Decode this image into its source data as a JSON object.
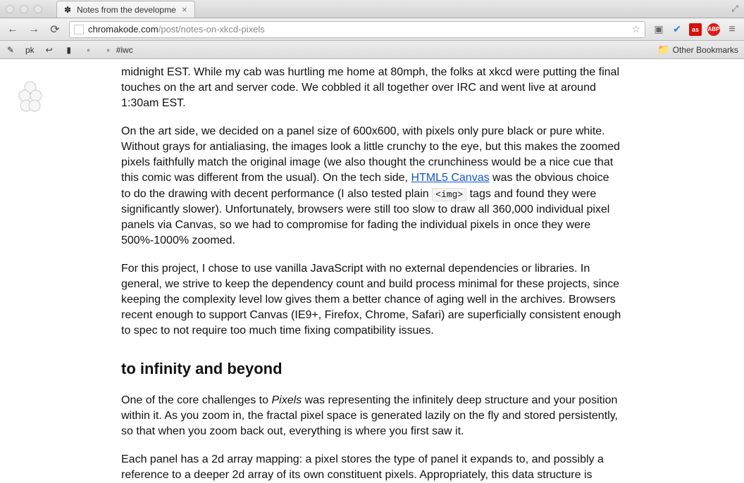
{
  "tab": {
    "title": "Notes from the developme",
    "close": "×"
  },
  "url": {
    "domain": "chromakode.com",
    "path": "/post/notes-on-xkcd-pixels"
  },
  "bookmarks": {
    "item1": "pk",
    "hashtag": "#iwc",
    "other": "Other Bookmarks"
  },
  "article": {
    "p1": "midnight EST. While my cab was hurtling me home at 80mph, the folks at xkcd were putting the final touches on the art and server code. We cobbled it all together over IRC and went live at around 1:30am EST.",
    "p2a": "On the art side, we decided on a panel size of 600x600, with pixels only pure black or pure white. Without grays for antialiasing, the images look a little crunchy to the eye, but this makes the zoomed pixels faithfully match the original image (we also thought the crunchiness would be a nice cue that this comic was different from the usual). On the tech side, ",
    "p2_link": "HTML5 Canvas",
    "p2b": " was the obvious choice to do the drawing with decent performance (I also tested plain ",
    "p2_code": "<img>",
    "p2c": " tags and found they were significantly slower). Unfortunately, browsers were still too slow to draw all 360,000 individual pixel panels via Canvas, so we had to compromise for fading the individual pixels in once they were 500%-1000% zoomed.",
    "p3": "For this project, I chose to use vanilla JavaScript with no external dependencies or libraries. In general, we strive to keep the dependency count and build process minimal for these projects, since keeping the complexity level low gives them a better chance of aging well in the archives. Browsers recent enough to support Canvas (IE9+, Firefox, Chrome, Safari) are superficially consistent enough to spec to not require too much time fixing compatibility issues.",
    "h2": "to infinity and beyond",
    "p4a": "One of the core challenges to ",
    "p4_em": "Pixels",
    "p4b": " was representing the infinitely deep structure and your position within it. As you zoom in, the fractal pixel space is generated lazily on the fly and stored persistently, so that when you zoom back out, everything is where you first saw it.",
    "p5": "Each panel has a 2d array mapping: a pixel stores the type of panel it expands to, and possibly a reference to a deeper 2d array of its own constituent pixels. Appropriately, this data structure is"
  }
}
